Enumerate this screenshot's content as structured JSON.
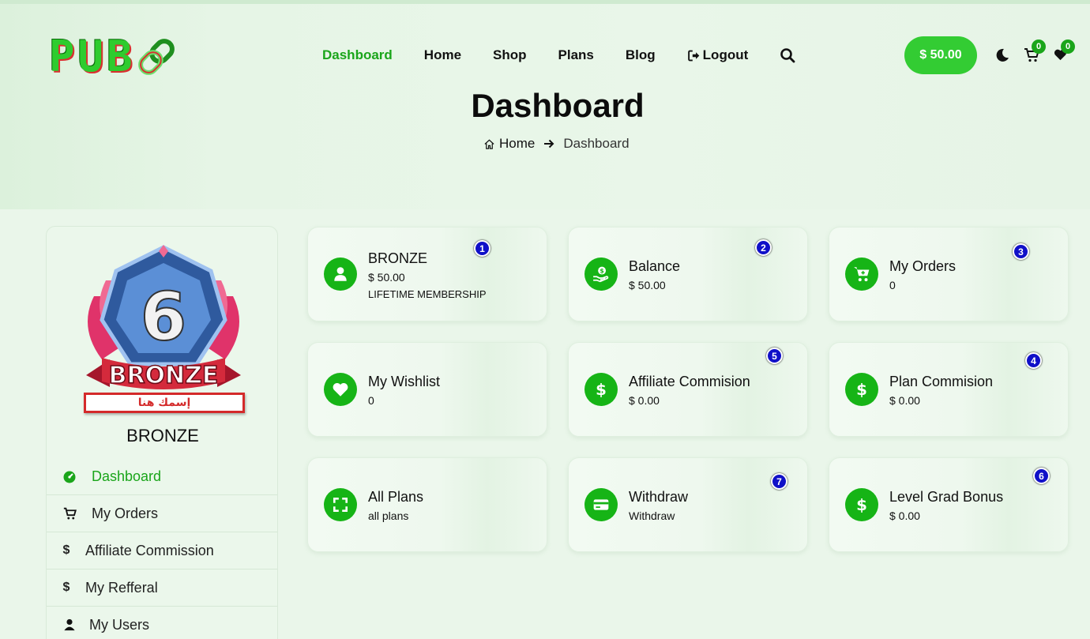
{
  "header": {
    "logo_text": "PUB",
    "nav": [
      "Dashboard",
      "Home",
      "Shop",
      "Plans",
      "Blog"
    ],
    "logout_label": "Logout",
    "balance_label": "$ 50.00",
    "cart_count": "0",
    "wishlist_count": "0"
  },
  "page": {
    "title": "Dashboard",
    "breadcrumb_home": "Home",
    "breadcrumb_current": "Dashboard"
  },
  "profile": {
    "badge_number": "6",
    "badge_label": "BRONZE",
    "name_placeholder": "إسمك هنا",
    "level_name": "BRONZE"
  },
  "sidebar": {
    "items": [
      "Dashboard",
      "My Orders",
      "Affiliate Commission",
      "My Refferal",
      "My Users"
    ]
  },
  "cards": [
    {
      "title": "BRONZE",
      "value": "$ 50.00",
      "sub": "LIFETIME MEMBERSHIP",
      "marker": "1",
      "icon": "user-icon"
    },
    {
      "title": "Balance",
      "value": "$ 50.00",
      "marker": "2",
      "icon": "hand-money-icon"
    },
    {
      "title": "My Orders",
      "value": "0",
      "marker": "3",
      "icon": "cart-icon"
    },
    {
      "title": "My Wishlist",
      "value": "0",
      "icon": "heart-icon"
    },
    {
      "title": "Affiliate Commision",
      "value": "$ 0.00",
      "marker": "5",
      "icon": "dollar-icon"
    },
    {
      "title": "Plan Commision",
      "value": "$ 0.00",
      "marker": "4",
      "icon": "dollar-icon"
    },
    {
      "title": "All Plans",
      "value": "all plans",
      "icon": "expand-icon"
    },
    {
      "title": "Withdraw",
      "value": "Withdraw",
      "marker": "7",
      "icon": "credit-card-icon"
    },
    {
      "title": "Level Grad Bonus",
      "value": "$ 0.00",
      "marker": "6",
      "icon": "dollar-icon"
    }
  ],
  "colors": {
    "accent": "#1aa51a",
    "button": "#33cc33",
    "marker": "#1010c8",
    "background": "#eaf6ea"
  }
}
